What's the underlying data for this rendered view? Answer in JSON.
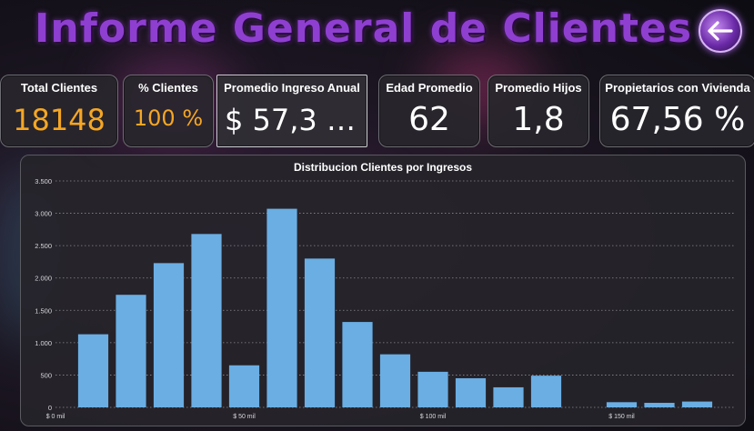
{
  "header": {
    "title": "Informe General  de Clientes",
    "back_icon": "back-arrow-icon"
  },
  "kpis": [
    {
      "label": "Total Clientes",
      "value": "18148",
      "color": "#f5a623"
    },
    {
      "label": "% Clientes",
      "value": "100 %",
      "color": "#f5a623"
    },
    {
      "label": "Promedio Ingreso Anual",
      "value": "$ 57,3 …",
      "color": "#ffffff"
    },
    {
      "label": "Edad Promedio",
      "value": "62",
      "color": "#ffffff"
    },
    {
      "label": "Promedio Hijos",
      "value": "1,8",
      "color": "#ffffff"
    },
    {
      "label": "Propietarios con Vivienda",
      "value": "67,56 %",
      "color": "#ffffff"
    }
  ],
  "chart_data": {
    "type": "bar",
    "title": "Distribucion Clientes por Ingresos",
    "xlabel": "",
    "ylabel": "",
    "bar_color": "#6aaee3",
    "x_tick_labels": [
      {
        "x": 0,
        "label": "$ 0 mil"
      },
      {
        "x": 50,
        "label": "$ 50 mil"
      },
      {
        "x": 100,
        "label": "$ 100 mil"
      },
      {
        "x": 150,
        "label": "$ 150 mil"
      }
    ],
    "xlim": [
      0,
      180
    ],
    "ylim": [
      0,
      3500
    ],
    "y_ticks": [
      0,
      500,
      1000,
      1500,
      2000,
      2500,
      3000,
      3500
    ],
    "y_tick_labels": [
      "0",
      "500",
      "1.000",
      "1.500",
      "2.000",
      "2.500",
      "3.000",
      "3.500"
    ],
    "grid": true,
    "x": [
      10,
      20,
      30,
      40,
      50,
      60,
      70,
      80,
      90,
      100,
      110,
      120,
      130,
      150,
      160,
      170
    ],
    "values": [
      1130,
      1740,
      2230,
      2680,
      650,
      3070,
      2300,
      1320,
      820,
      550,
      450,
      310,
      490,
      80,
      70,
      90
    ]
  }
}
